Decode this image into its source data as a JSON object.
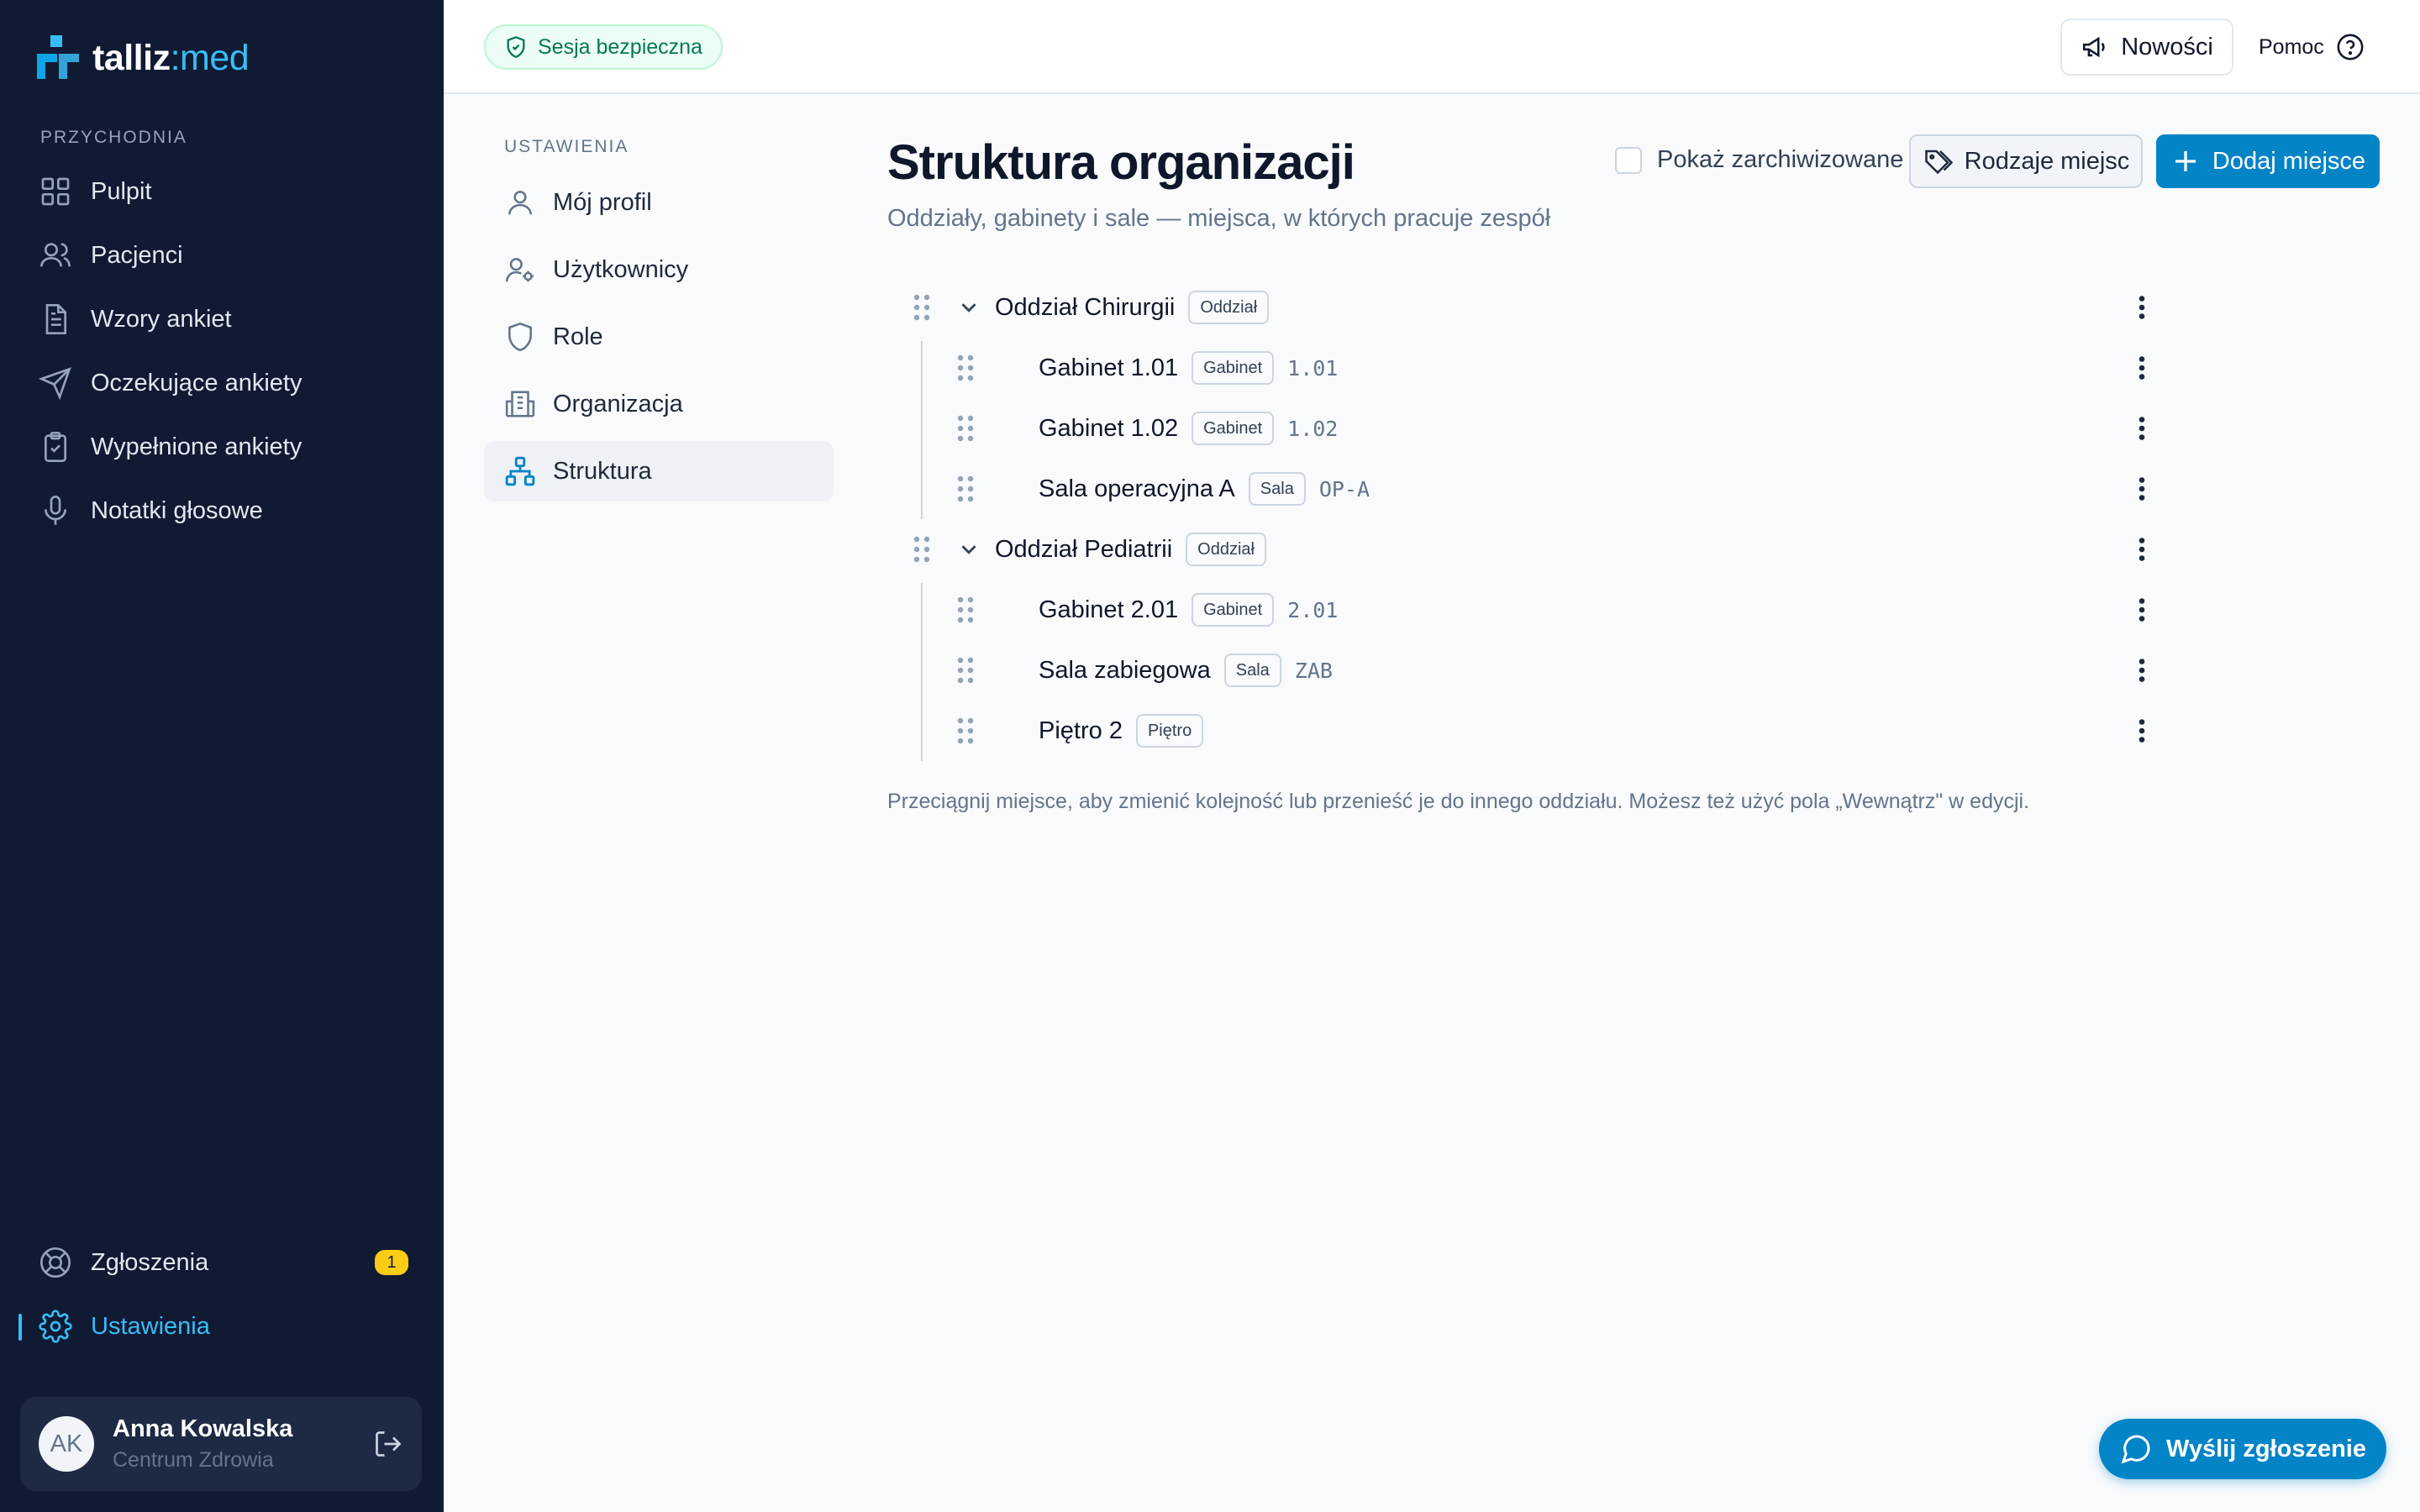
{
  "brand": {
    "name_main": "talliz",
    "name_sep": ":",
    "name_accent": "med"
  },
  "sidebar": {
    "section_label": "PRZYCHODNIA",
    "items": [
      {
        "label": "Pulpit",
        "icon": "grid-icon"
      },
      {
        "label": "Pacjenci",
        "icon": "users-icon"
      },
      {
        "label": "Wzory ankiet",
        "icon": "document-icon"
      },
      {
        "label": "Oczekujące ankiety",
        "icon": "send-icon"
      },
      {
        "label": "Wypełnione ankiety",
        "icon": "clipboard-check-icon"
      },
      {
        "label": "Notatki głosowe",
        "icon": "microphone-icon"
      }
    ],
    "bottom_items": [
      {
        "label": "Zgłoszenia",
        "icon": "lifebuoy-icon",
        "badge": "1"
      },
      {
        "label": "Ustawienia",
        "icon": "gear-icon",
        "active": true
      }
    ],
    "user": {
      "initials": "AK",
      "name": "Anna Kowalska",
      "organization": "Centrum Zdrowia"
    }
  },
  "topbar": {
    "secure_label": "Sesja bezpieczna",
    "news_label": "Nowości",
    "help_label": "Pomoc"
  },
  "settings_nav": {
    "label": "USTAWIENIA",
    "items": [
      {
        "label": "Mój profil",
        "icon": "user-icon"
      },
      {
        "label": "Użytkownicy",
        "icon": "user-cog-icon"
      },
      {
        "label": "Role",
        "icon": "shield-icon"
      },
      {
        "label": "Organizacja",
        "icon": "building-icon"
      },
      {
        "label": "Struktura",
        "icon": "hierarchy-icon",
        "active": true
      }
    ]
  },
  "page": {
    "title": "Struktura organizacji",
    "subtitle": "Oddziały, gabinety i sale — miejsca, w których pracuje zespół",
    "show_archived_label": "Pokaż zarchiwizowane",
    "show_archived_checked": false,
    "types_button": "Rodzaje miejsc",
    "add_button": "Dodaj miejsce",
    "hint": "Przeciągnij miejsce, aby zmienić kolejność lub przenieść je do innego oddziału. Możesz też użyć pola „Wewnątrz\" w edycji."
  },
  "tree": [
    {
      "name": "Oddział Chirurgii",
      "type": "Oddział",
      "expanded": true,
      "children": [
        {
          "name": "Gabinet 1.01",
          "type": "Gabinet",
          "code": "1.01"
        },
        {
          "name": "Gabinet 1.02",
          "type": "Gabinet",
          "code": "1.02"
        },
        {
          "name": "Sala operacyjna A",
          "type": "Sala",
          "code": "OP-A"
        }
      ]
    },
    {
      "name": "Oddział Pediatrii",
      "type": "Oddział",
      "expanded": true,
      "children": [
        {
          "name": "Gabinet 2.01",
          "type": "Gabinet",
          "code": "2.01"
        },
        {
          "name": "Sala zabiegowa",
          "type": "Sala",
          "code": "ZAB"
        },
        {
          "name": "Piętro 2",
          "type": "Piętro",
          "code": ""
        }
      ]
    }
  ],
  "fab": {
    "label": "Wyślij zgłoszenie"
  },
  "colors": {
    "sidebar_bg": "#111a33",
    "accent": "#38bdf8",
    "primary": "#0284c7",
    "badge": "#facc15",
    "secure_green": "#047857"
  }
}
